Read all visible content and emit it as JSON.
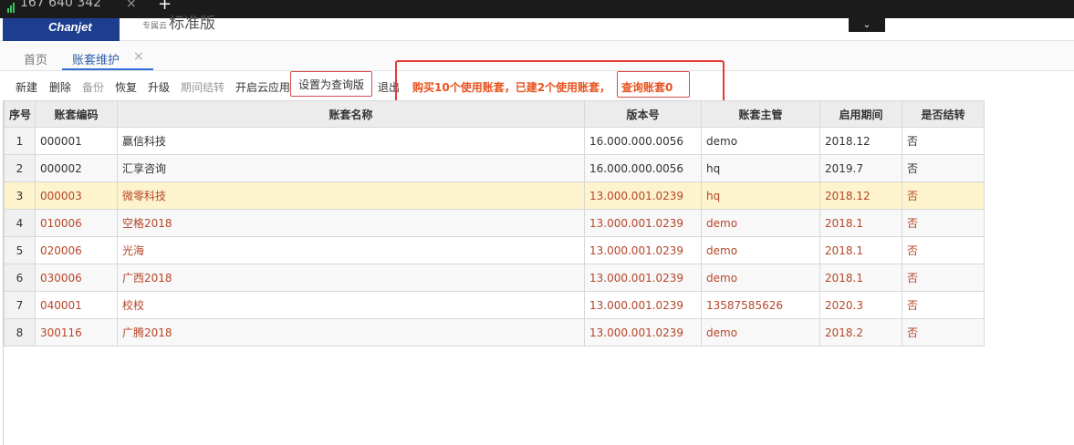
{
  "browser": {
    "ip_text": "167 640 342",
    "close_glyph": "×",
    "newtab_glyph": "+",
    "signal_icon": "signal-bars-icon"
  },
  "header": {
    "logo_text": "Chanjet",
    "edition_small": "专属云",
    "edition": "标准版",
    "dropdown_glyph": "⌄",
    "logo_color": "#1d3e8f"
  },
  "tabs": {
    "home": "首页",
    "active": "账套维护",
    "close_glyph": "×",
    "active_color": "#2f6fd6"
  },
  "toolbar": {
    "new": "新建",
    "delete": "删除",
    "backup": "备份",
    "restore": "恢复",
    "upgrade": "升级",
    "period_close": "期间结转",
    "cloud_app": "开启云应用",
    "set_query": "设置为查询版",
    "exit": "退出"
  },
  "notice": {
    "text": "购买10个使用账套，已建2个使用账套，",
    "query": "查询账套0",
    "color": "#e8521e",
    "box_color": "#e53935"
  },
  "table": {
    "columns": [
      "序号",
      "账套编码",
      "账套名称",
      "版本号",
      "账套主管",
      "启用期间",
      "是否结转"
    ],
    "rows": [
      [
        "1",
        "000001",
        "赢信科技",
        "16.000.000.0056",
        "demo",
        "2018.12",
        "否"
      ],
      [
        "2",
        "000002",
        "汇享咨询",
        "16.000.000.0056",
        "hq",
        "2019.7",
        "否"
      ],
      [
        "3",
        "000003",
        "微零科技",
        "13.000.001.0239",
        "hq",
        "2018.12",
        "否"
      ],
      [
        "4",
        "010006",
        "空格2018",
        "13.000.001.0239",
        "demo",
        "2018.1",
        "否"
      ],
      [
        "5",
        "020006",
        "光海",
        "13.000.001.0239",
        "demo",
        "2018.1",
        "否"
      ],
      [
        "6",
        "030006",
        "广西2018",
        "13.000.001.0239",
        "demo",
        "2018.1",
        "否"
      ],
      [
        "7",
        "040001",
        "校校",
        "13.000.001.0239",
        "13587585626",
        "2020.3",
        "否"
      ],
      [
        "8",
        "300116",
        "广腾2018",
        "13.000.001.0239",
        "demo",
        "2018.2",
        "否"
      ]
    ],
    "selected_row": 3,
    "legacy_text_color": "#b5462a",
    "selected_bg": "#fdf3cd"
  }
}
